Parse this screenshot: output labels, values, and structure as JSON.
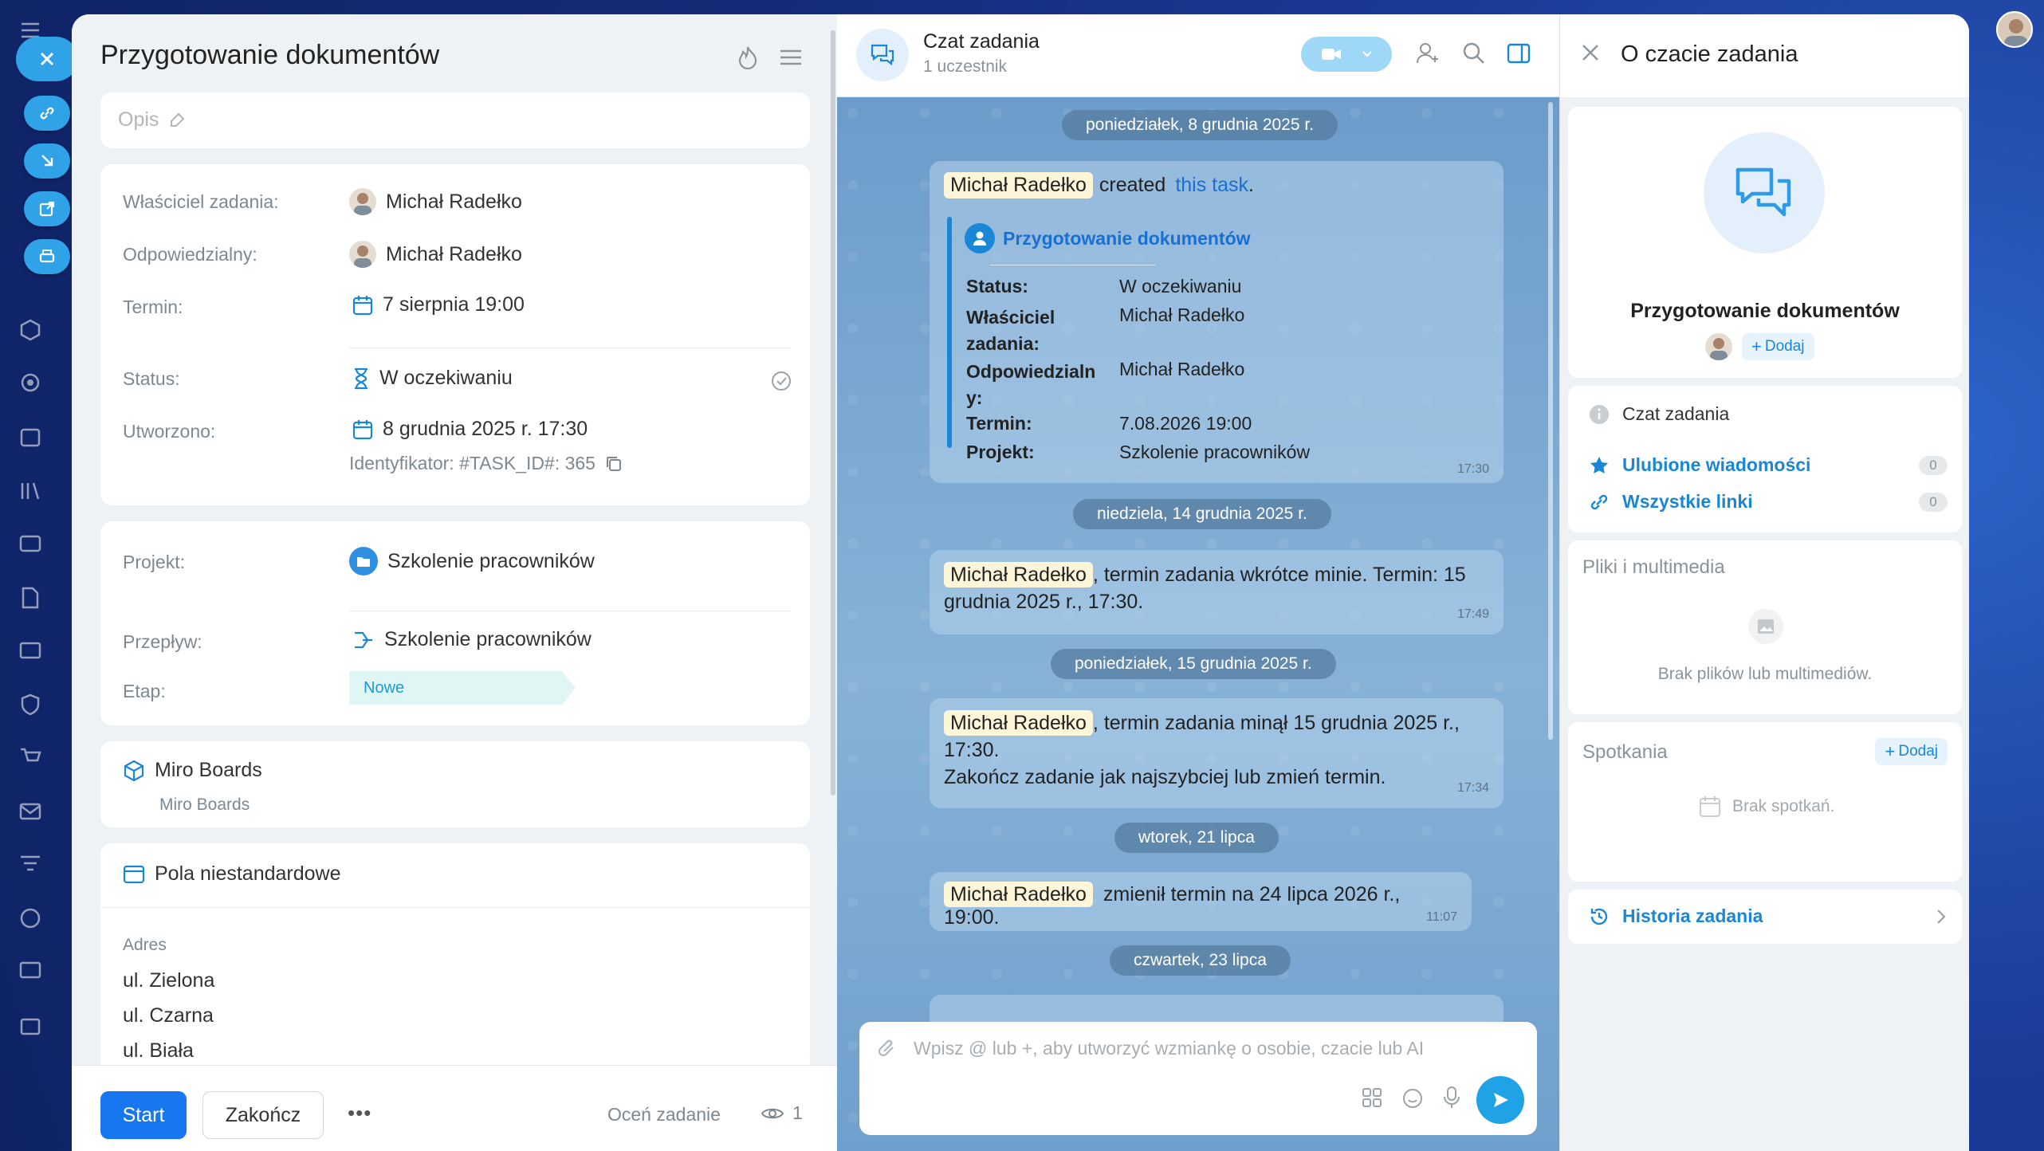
{
  "colors": {
    "accent": "#1677f0",
    "link": "#1a86d6",
    "chat_bg": "#7aa8cf",
    "name_highlight": "#fff5d8",
    "stage_bg": "#dff6f5"
  },
  "task": {
    "title": "Przygotowanie dokumentów",
    "description_placeholder": "Opis",
    "fields": {
      "owner_label": "Właściciel zadania:",
      "owner_value": "Michał Radełko",
      "responsible_label": "Odpowiedzialny:",
      "responsible_value": "Michał Radełko",
      "deadline_label": "Termin:",
      "deadline_value": "7 sierpnia 19:00",
      "status_label": "Status:",
      "status_value": "W oczekiwaniu",
      "created_label": "Utworzono:",
      "created_value": "8 grudnia 2025 r. 17:30",
      "identifier": "Identyfikator: #TASK_ID#: 365"
    },
    "project": {
      "project_label": "Projekt:",
      "project_value": "Szkolenie pracowników",
      "flow_label": "Przepływ:",
      "flow_value": "Szkolenie pracowników",
      "stage_label": "Etap:",
      "stage_value": "Nowe"
    },
    "miro": {
      "title": "Miro Boards",
      "subtitle": "Miro Boards"
    },
    "custom_fields": {
      "title": "Pola niestandardowe",
      "address_label": "Adres",
      "addresses": [
        "ul. Zielona",
        "ul. Czarna",
        "ul. Biała"
      ]
    },
    "footer": {
      "start": "Start",
      "finish": "Zakończ",
      "more": "•••",
      "rate": "Oceń zadanie",
      "views": "1"
    }
  },
  "chat": {
    "title": "Czat zadania",
    "participants": "1 uczestnik",
    "dates": [
      "poniedziałek, 8 grudnia 2025 r.",
      "niedziela, 14 grudnia 2025 r.",
      "poniedziałek, 15 grudnia 2025 r.",
      "wtorek, 21 lipca",
      "czwartek, 23 lipca"
    ],
    "msg1": {
      "name": "Michał Radełko",
      "text": "created",
      "link": "this task",
      "dot": ".",
      "card_title": "Przygotowanie dokumentów",
      "rows": [
        {
          "k": "Status:",
          "v": "W oczekiwaniu"
        },
        {
          "k": "Właściciel zadania:",
          "v": "Michał Radełko"
        },
        {
          "k": "Odpowiedzialny:",
          "v": "Michał Radełko"
        },
        {
          "k": "Termin:",
          "v": "7.08.2026 19:00"
        },
        {
          "k": "Projekt:",
          "v": "Szkolenie pracowników"
        }
      ],
      "time": "17:30"
    },
    "msg2": {
      "name": "Michał Radełko",
      "text": ", termin zadania wkrótce minie. Termin: 15 grudnia 2025 r., 17:30.",
      "time": "17:49"
    },
    "msg3": {
      "name": "Michał Radełko",
      "text": ", termin zadania minął 15 grudnia 2025 r., 17:30.",
      "text2": "Zakończ zadanie jak najszybciej lub zmień termin.",
      "time": "17:34"
    },
    "msg4": {
      "name": "Michał Radełko",
      "text": "zmienił termin na 24 lipca 2026 r., 19:00.",
      "time": "11:07"
    },
    "input_placeholder": "Wpisz @ lub +, aby utworzyć wzmiankę o osobie, czacie lub AI"
  },
  "info": {
    "title": "O czacie zadania",
    "chat_name": "Przygotowanie dokumentów",
    "add": "Dodaj",
    "chat_label": "Czat zadania",
    "favorites": "Ulubione wiadomości",
    "favorites_count": "0",
    "links": "Wszystkie linki",
    "links_count": "0",
    "files_title": "Pliki i multimedia",
    "files_empty": "Brak plików lub multimediów.",
    "meetings_title": "Spotkania",
    "meetings_empty": "Brak spotkań.",
    "history": "Historia zadania"
  }
}
